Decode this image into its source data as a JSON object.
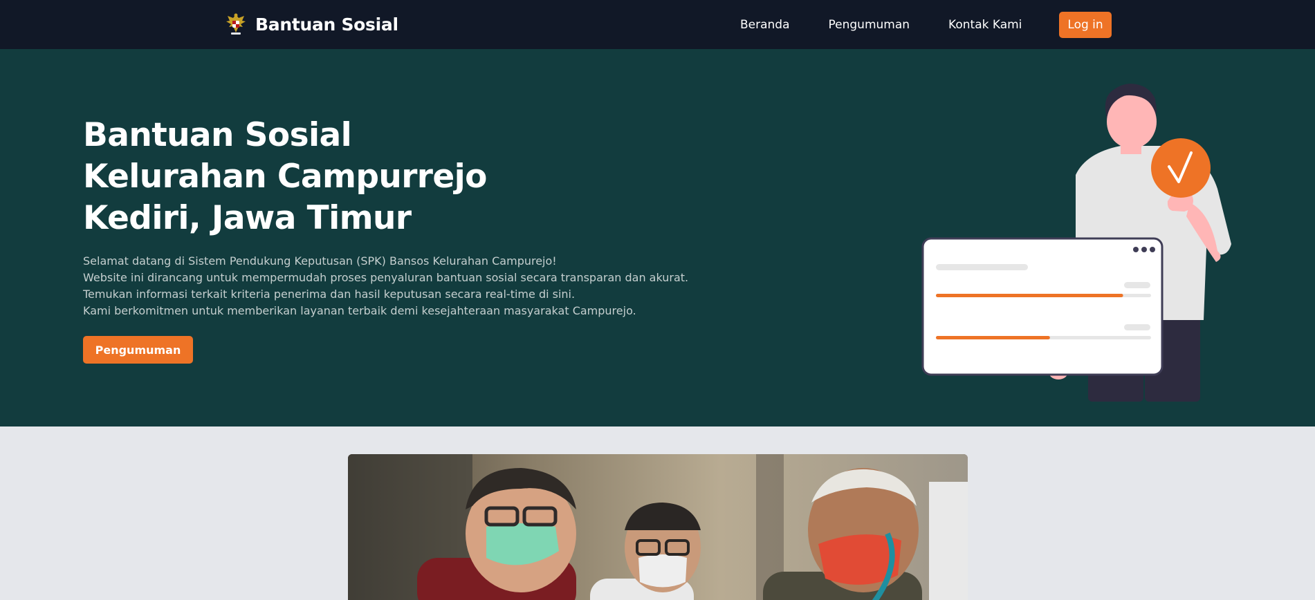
{
  "navbar": {
    "brand_name": "Bantuan Sosial",
    "logo_icon": "garuda-emblem-icon",
    "links": [
      {
        "label": "Beranda"
      },
      {
        "label": "Pengumuman"
      },
      {
        "label": "Kontak Kami"
      }
    ],
    "login_label": "Log in"
  },
  "hero": {
    "title_lines": [
      "Bantuan Sosial",
      "Kelurahan Campurrejo",
      "Kediri, Jawa Timur"
    ],
    "description_lines": [
      "Selamat datang di Sistem Pendukung Keputusan (SPK) Bansos Kelurahan Campurejo!",
      "Website ini dirancang untuk mempermudah proses penyaluran bantuan sosial secara transparan dan akurat.",
      "Temukan informasi terkait kriteria penerima dan hasil keputusan secara real-time di sini.",
      "Kami berkomitmen untuk memberikan layanan terbaik demi kesejahteraan masyarakat Campurejo."
    ],
    "button_label": "Pengumuman",
    "illustration": {
      "icon": "person-with-checkmark-and-progress-card-illustration",
      "progress_1": 0.87,
      "progress_2": 0.53
    }
  },
  "photo": {
    "description_icon": "photo-aid-distribution-image"
  },
  "colors": {
    "navbar_bg": "#111827",
    "hero_bg": "#123c3e",
    "accent": "#ee7326",
    "page_bg": "#e5e7eb"
  }
}
